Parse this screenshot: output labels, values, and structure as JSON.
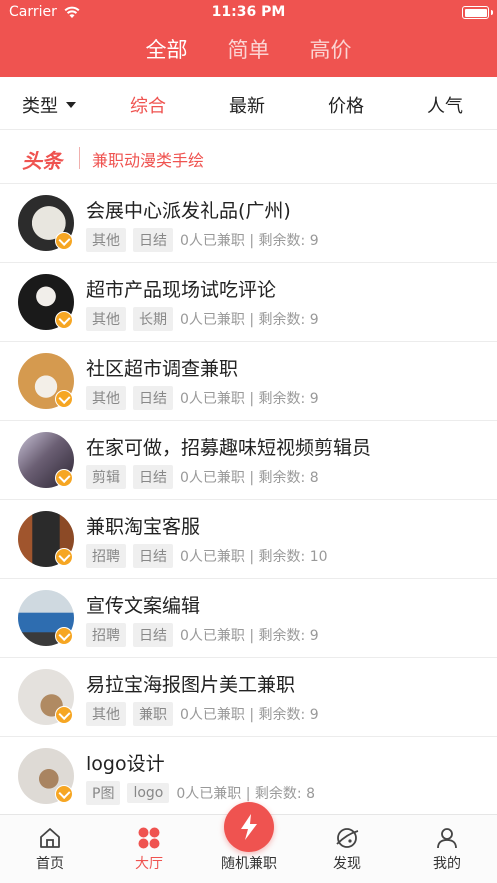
{
  "status_bar": {
    "carrier": "Carrier",
    "time": "11:36 PM"
  },
  "top_tabs": [
    {
      "label": "全部",
      "active": true
    },
    {
      "label": "简单",
      "active": false
    },
    {
      "label": "高价",
      "active": false
    }
  ],
  "filters": {
    "type_label": "类型",
    "sort_tabs": [
      "综合",
      "最新",
      "价格",
      "人气"
    ],
    "active_sort": "综合"
  },
  "headline": {
    "badge": "头条",
    "text": "兼职动漫类手绘"
  },
  "jobs": [
    {
      "title": "会展中心派发礼品(广州)",
      "tags": [
        "其他",
        "日结"
      ],
      "meta": "0人已兼职 | 剩余数: 9"
    },
    {
      "title": "超市产品现场试吃评论",
      "tags": [
        "其他",
        "长期"
      ],
      "meta": "0人已兼职 | 剩余数: 9"
    },
    {
      "title": "社区超市调查兼职",
      "tags": [
        "其他",
        "日结"
      ],
      "meta": "0人已兼职 | 剩余数: 9"
    },
    {
      "title": "在家可做，招募趣味短视频剪辑员",
      "tags": [
        "剪辑",
        "日结"
      ],
      "meta": "0人已兼职 | 剩余数: 8"
    },
    {
      "title": "兼职淘宝客服",
      "tags": [
        "招聘",
        "日结"
      ],
      "meta": "0人已兼职 | 剩余数: 10"
    },
    {
      "title": "宣传文案编辑",
      "tags": [
        "招聘",
        "日结"
      ],
      "meta": "0人已兼职 | 剩余数: 9"
    },
    {
      "title": "易拉宝海报图片美工兼职",
      "tags": [
        "其他",
        "兼职"
      ],
      "meta": "0人已兼职 | 剩余数: 9"
    },
    {
      "title": "logo设计",
      "tags": [
        "P图",
        "logo"
      ],
      "meta": "0人已兼职 | 剩余数: 8"
    }
  ],
  "nav": {
    "home": "首页",
    "hall": "大厅",
    "random": "随机兼职",
    "discover": "发现",
    "mine": "我的"
  },
  "colors": {
    "accent": "#ef5350",
    "badge": "#f6a623"
  }
}
